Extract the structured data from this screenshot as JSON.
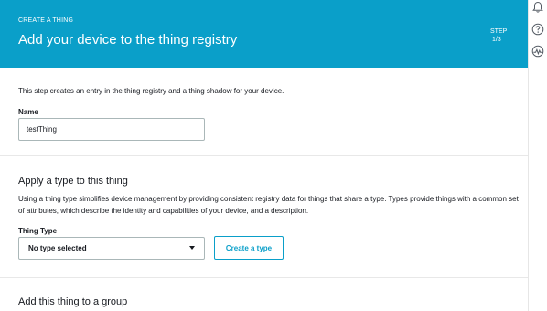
{
  "header": {
    "eyebrow": "CREATE A THING",
    "title": "Add your device to the thing registry",
    "step_label": "STEP",
    "step_value": "1/3"
  },
  "form": {
    "intro": "This step creates an entry in the thing registry and a thing shadow for your device.",
    "name_label": "Name",
    "name_value": "testThing"
  },
  "type_section": {
    "title": "Apply a type to this thing",
    "description": "Using a thing type simplifies device management by providing consistent registry data for things that share a type. Types provide things with a common set of attributes, which describe the identity and capabilities of your device, and a description.",
    "field_label": "Thing Type",
    "select_value": "No type selected",
    "create_button": "Create a type"
  },
  "group_section": {
    "title": "Add this thing to a group"
  },
  "right_rail": {
    "icons": [
      "bell-icon",
      "help-icon",
      "activity-icon"
    ]
  },
  "colors": {
    "header_bg": "#0a9fc9",
    "accent": "#0a9fc9"
  }
}
